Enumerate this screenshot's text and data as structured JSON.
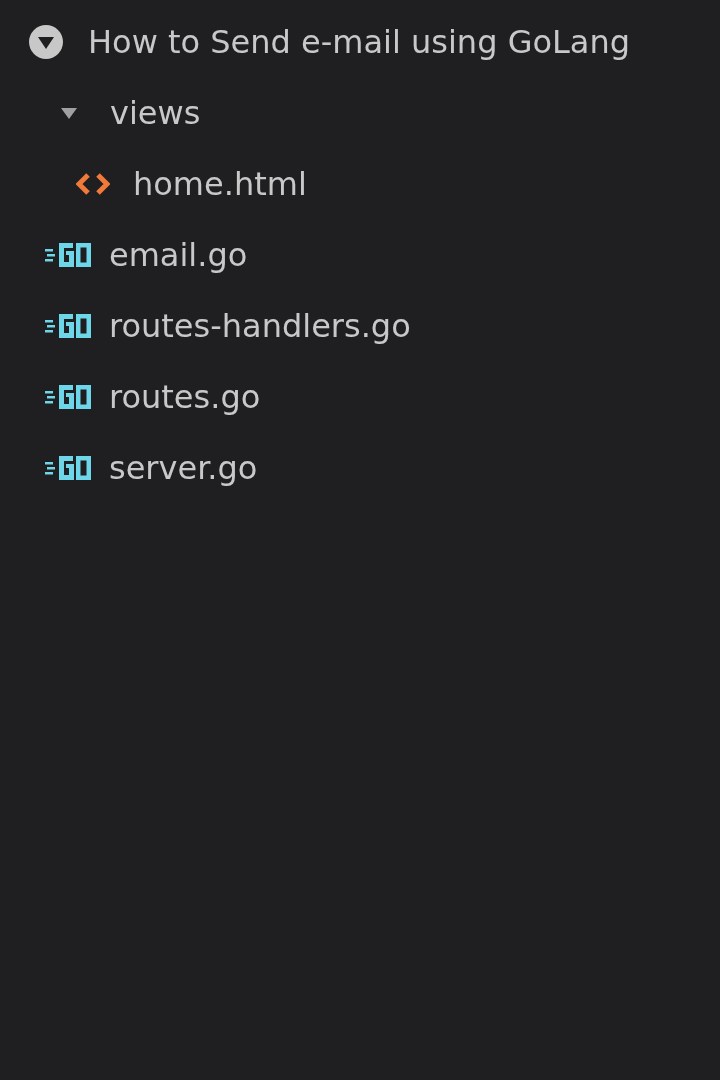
{
  "tree": {
    "label": "How to Send e-mail using GoLang",
    "expanded": true,
    "children": [
      {
        "label": "views",
        "kind": "folder",
        "expanded": true,
        "children": [
          {
            "label": "home.html",
            "kind": "html"
          }
        ]
      },
      {
        "label": "email.go",
        "kind": "go"
      },
      {
        "label": "routes-handlers.go",
        "kind": "go"
      },
      {
        "label": "routes.go",
        "kind": "go"
      },
      {
        "label": "server.go",
        "kind": "go"
      }
    ]
  }
}
